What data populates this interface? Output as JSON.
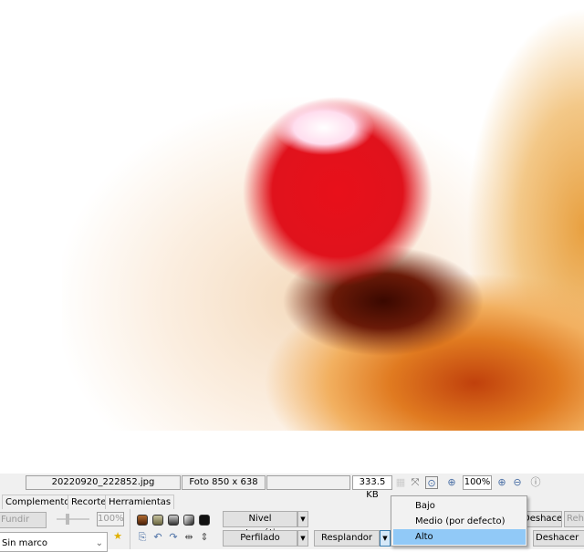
{
  "status": {
    "filename": "20220920_222852.jpg",
    "dimensions": "Foto 850 x 638",
    "filesize": "333.5 KB",
    "zoom": "100%"
  },
  "tabs": [
    "Complementos",
    "Recorte",
    "Herramientas"
  ],
  "left_panel": {
    "blend_button": "Fundir",
    "opacity": "100%",
    "frame_select": "Sin marco"
  },
  "tools": {
    "auto_level": "Nivel automático",
    "profile": "Perfilado",
    "glow": "Resplandor",
    "undo": "Deshacer",
    "redo": "Rehacer",
    "undo_all": "Deshacer todo"
  },
  "dropdown_menu": {
    "items": [
      "Bajo",
      "Medio (por defecto)",
      "Alto"
    ],
    "selected": "Alto"
  }
}
